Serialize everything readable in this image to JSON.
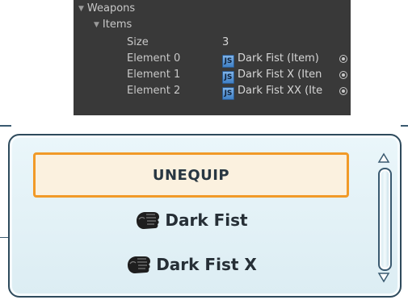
{
  "inspector": {
    "weapons_label": "Weapons",
    "items_label": "Items",
    "size_label": "Size",
    "size_value": "3",
    "elements": [
      {
        "label": "Element 0",
        "value": "Dark Fist (Item)"
      },
      {
        "label": "Element 1",
        "value": "Dark Fist X (Iten"
      },
      {
        "label": "Element 2",
        "value": "Dark Fist XX (Ite"
      }
    ],
    "script_icon_text": "JS"
  },
  "inventory": {
    "unequip_label": "UNEQUIP",
    "items": [
      {
        "label": "Dark Fist",
        "icon": "fist-icon"
      },
      {
        "label": "Dark Fist X",
        "icon": "fist-icon"
      }
    ],
    "scroll_up_icon": "triangle-up-icon",
    "scroll_down_icon": "triangle-down-icon"
  },
  "colors": {
    "inspector_bg": "#393939",
    "unequip_border": "#f19a28",
    "unequip_bg": "#fbf1df",
    "panel_bg": "#e3f2f7",
    "panel_border": "#2e4a5c"
  }
}
